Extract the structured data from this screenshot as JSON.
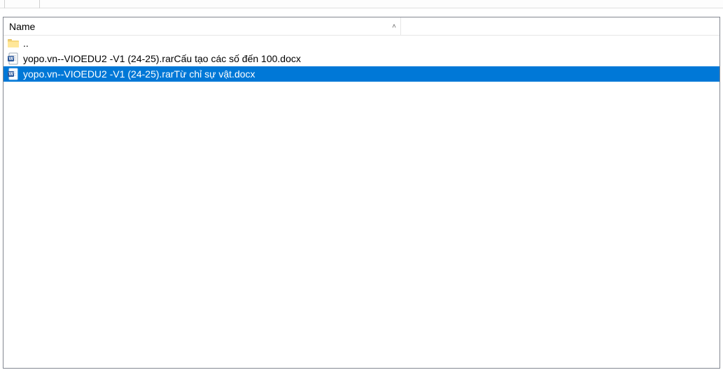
{
  "columns": {
    "name": "Name",
    "sort_arrow": "˄"
  },
  "rows": [
    {
      "type": "folder",
      "name": ".."
    },
    {
      "type": "docx",
      "name": "yopo.vn--VIOEDU2 -V1 (24-25).rarCấu tạo các số đến 100.docx"
    },
    {
      "type": "docx",
      "name": "yopo.vn--VIOEDU2 -V1 (24-25).rarTừ chỉ sự vật.docx",
      "selected": true
    }
  ]
}
